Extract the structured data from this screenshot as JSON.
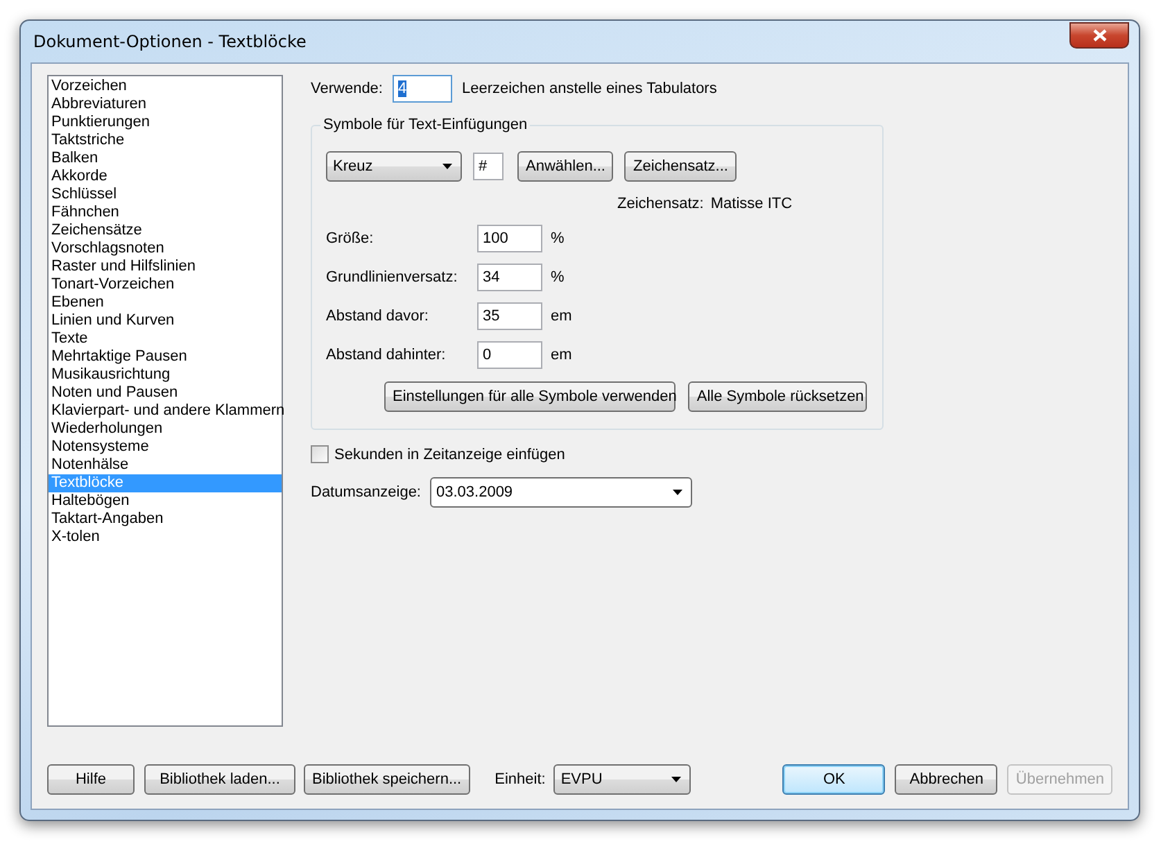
{
  "window": {
    "title": "Dokument-Optionen - Textblöcke"
  },
  "categories": [
    {
      "label": "Vorzeichen",
      "selected": false
    },
    {
      "label": "Abbreviaturen",
      "selected": false
    },
    {
      "label": "Punktierungen",
      "selected": false
    },
    {
      "label": "Taktstriche",
      "selected": false
    },
    {
      "label": "Balken",
      "selected": false
    },
    {
      "label": "Akkorde",
      "selected": false
    },
    {
      "label": "Schlüssel",
      "selected": false
    },
    {
      "label": "Fähnchen",
      "selected": false
    },
    {
      "label": "Zeichensätze",
      "selected": false
    },
    {
      "label": "Vorschlagsnoten",
      "selected": false
    },
    {
      "label": "Raster und Hilfslinien",
      "selected": false
    },
    {
      "label": "Tonart-Vorzeichen",
      "selected": false
    },
    {
      "label": "Ebenen",
      "selected": false
    },
    {
      "label": "Linien und Kurven",
      "selected": false
    },
    {
      "label": "Texte",
      "selected": false
    },
    {
      "label": "Mehrtaktige Pausen",
      "selected": false
    },
    {
      "label": "Musikausrichtung",
      "selected": false
    },
    {
      "label": "Noten und Pausen",
      "selected": false
    },
    {
      "label": "Klavierpart- und andere Klammern",
      "selected": false
    },
    {
      "label": "Wiederholungen",
      "selected": false
    },
    {
      "label": "Notensysteme",
      "selected": false
    },
    {
      "label": "Notenhälse",
      "selected": false
    },
    {
      "label": "Textblöcke",
      "selected": true
    },
    {
      "label": "Haltebögen",
      "selected": false
    },
    {
      "label": "Taktart-Angaben",
      "selected": false
    },
    {
      "label": "X-tolen",
      "selected": false
    }
  ],
  "spaces": {
    "label": "Verwende:",
    "value": "4",
    "suffix": "Leerzeichen anstelle eines Tabulators"
  },
  "symbols_group": {
    "title": "Symbole für Text-Einfügungen",
    "symbol": "Kreuz",
    "character": "#",
    "buttons": [
      "Anwählen...",
      "Zeichensatz..."
    ],
    "font_label": "Zeichensatz:",
    "font_value": "Matisse ITC",
    "fields": [
      {
        "label": "Größe:",
        "value": "100",
        "unit": "%"
      },
      {
        "label": "Grundlinienversatz:",
        "value": "34",
        "unit": "%"
      },
      {
        "label": "Abstand davor:",
        "value": "35",
        "unit": "em"
      },
      {
        "label": "Abstand dahinter:",
        "value": "0",
        "unit": "em"
      }
    ],
    "actions": [
      "Einstellungen für alle Symbole verwenden",
      "Alle Symbole rücksetzen"
    ]
  },
  "seconds_checkbox": {
    "label": "Sekunden in Zeitanzeige einfügen",
    "checked": false
  },
  "date_display": {
    "label": "Datumsanzeige:",
    "value": "03.03.2009"
  },
  "footer": {
    "left_buttons": [
      "Hilfe",
      "Bibliothek laden...",
      "Bibliothek speichern..."
    ],
    "unit_label": "Einheit:",
    "unit_value": "EVPU",
    "right_buttons": [
      {
        "label": "OK",
        "default": true,
        "disabled": false
      },
      {
        "label": "Abbrechen",
        "default": false,
        "disabled": false
      },
      {
        "label": "Übernehmen",
        "default": false,
        "disabled": true
      }
    ]
  }
}
